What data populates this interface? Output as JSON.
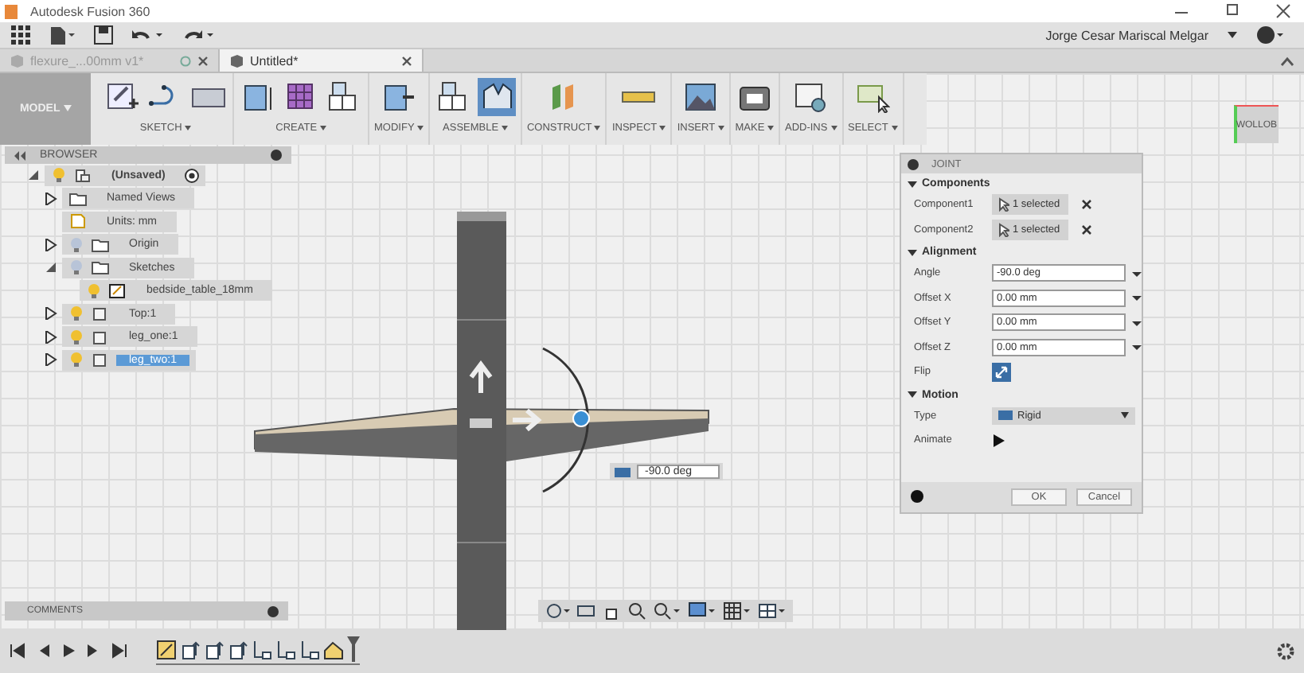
{
  "window": {
    "title": "Autodesk Fusion 360",
    "user": "Jorge Cesar Mariscal Melgar"
  },
  "doc_tabs": [
    {
      "label": "flexure_...00mm v1*",
      "selected": false
    },
    {
      "label": "Untitled*",
      "selected": true
    }
  ],
  "ribbon": {
    "workspace": "MODEL",
    "groups": [
      {
        "label": "SKETCH",
        "tools": [
          {
            "kind": "sketch",
            "selected": false
          },
          {
            "kind": "arc",
            "selected": false
          },
          {
            "kind": "rect",
            "selected": false
          }
        ]
      },
      {
        "label": "CREATE",
        "tools": [
          {
            "kind": "box",
            "selected": false
          },
          {
            "kind": "grid",
            "selected": false
          },
          {
            "kind": "component",
            "selected": false
          }
        ]
      },
      {
        "label": "MODIFY",
        "tools": [
          {
            "kind": "push",
            "selected": false
          }
        ]
      },
      {
        "label": "ASSEMBLE",
        "tools": [
          {
            "kind": "component",
            "selected": false
          },
          {
            "kind": "joint",
            "selected": true
          }
        ]
      },
      {
        "label": "CONSTRUCT",
        "tools": [
          {
            "kind": "plane",
            "selected": false
          }
        ]
      },
      {
        "label": "INSPECT",
        "tools": [
          {
            "kind": "measure",
            "selected": false
          }
        ]
      },
      {
        "label": "INSERT",
        "tools": [
          {
            "kind": "picture",
            "selected": false
          }
        ]
      },
      {
        "label": "MAKE",
        "tools": [
          {
            "kind": "printer",
            "selected": false
          }
        ]
      },
      {
        "label": "ADD-INS",
        "tools": [
          {
            "kind": "script",
            "selected": false
          }
        ]
      },
      {
        "label": "SELECT",
        "tools": [
          {
            "kind": "select",
            "selected": false
          }
        ]
      }
    ]
  },
  "browser": {
    "title": "BROWSER",
    "tree": [
      {
        "kind": "root",
        "label": "(Unsaved)",
        "expanded": true,
        "visible": true,
        "selected": false,
        "children": [
          {
            "kind": "folder",
            "label": "Named Views",
            "expanded": false,
            "selected": false
          },
          {
            "kind": "units",
            "label": "Units: mm",
            "selected": false
          },
          {
            "kind": "folder",
            "label": "Origin",
            "expanded": false,
            "visible": false,
            "selected": false
          },
          {
            "kind": "folder",
            "label": "Sketches",
            "expanded": true,
            "visible": false,
            "selected": false,
            "children": [
              {
                "kind": "sketch",
                "label": "bedside_table_18mm",
                "visible": true,
                "selected": false
              }
            ]
          },
          {
            "kind": "component",
            "label": "Top:1",
            "expanded": false,
            "visible": true,
            "selected": false
          },
          {
            "kind": "component",
            "label": "leg_one:1",
            "expanded": false,
            "visible": true,
            "selected": false
          },
          {
            "kind": "component",
            "label": "leg_two:1",
            "expanded": false,
            "visible": true,
            "selected": true
          }
        ]
      }
    ]
  },
  "comments": {
    "title": "COMMENTS"
  },
  "viewcube": {
    "label": "WOLLOB"
  },
  "angle_field": {
    "value": "-90.0 deg"
  },
  "joint": {
    "title": "JOINT",
    "sections": [
      {
        "title": "Components",
        "expanded": true,
        "rows": [
          {
            "kind": "select",
            "label": "Component1",
            "value": "1 selected"
          },
          {
            "kind": "select",
            "label": "Component2",
            "value": "1 selected"
          }
        ]
      },
      {
        "title": "Alignment",
        "expanded": true,
        "rows": [
          {
            "kind": "input",
            "label": "Angle",
            "value": "-90.0 deg"
          },
          {
            "kind": "input",
            "label": "Offset X",
            "value": "0.00 mm"
          },
          {
            "kind": "input",
            "label": "Offset Y",
            "value": "0.00 mm"
          },
          {
            "kind": "input",
            "label": "Offset Z",
            "value": "0.00 mm"
          },
          {
            "kind": "toggle",
            "label": "Flip",
            "on": true
          }
        ]
      },
      {
        "title": "Motion",
        "expanded": true,
        "rows": [
          {
            "kind": "dropdown",
            "label": "Type",
            "value": "Rigid"
          },
          {
            "kind": "play",
            "label": "Animate"
          }
        ]
      }
    ],
    "buttons": [
      "OK",
      "Cancel"
    ]
  },
  "timeline": {
    "items": [
      {
        "kind": "sketch"
      },
      {
        "kind": "extrude"
      },
      {
        "kind": "extrude"
      },
      {
        "kind": "extrude"
      },
      {
        "kind": "joint"
      },
      {
        "kind": "joint"
      },
      {
        "kind": "joint"
      },
      {
        "kind": "asbuilt"
      }
    ]
  }
}
